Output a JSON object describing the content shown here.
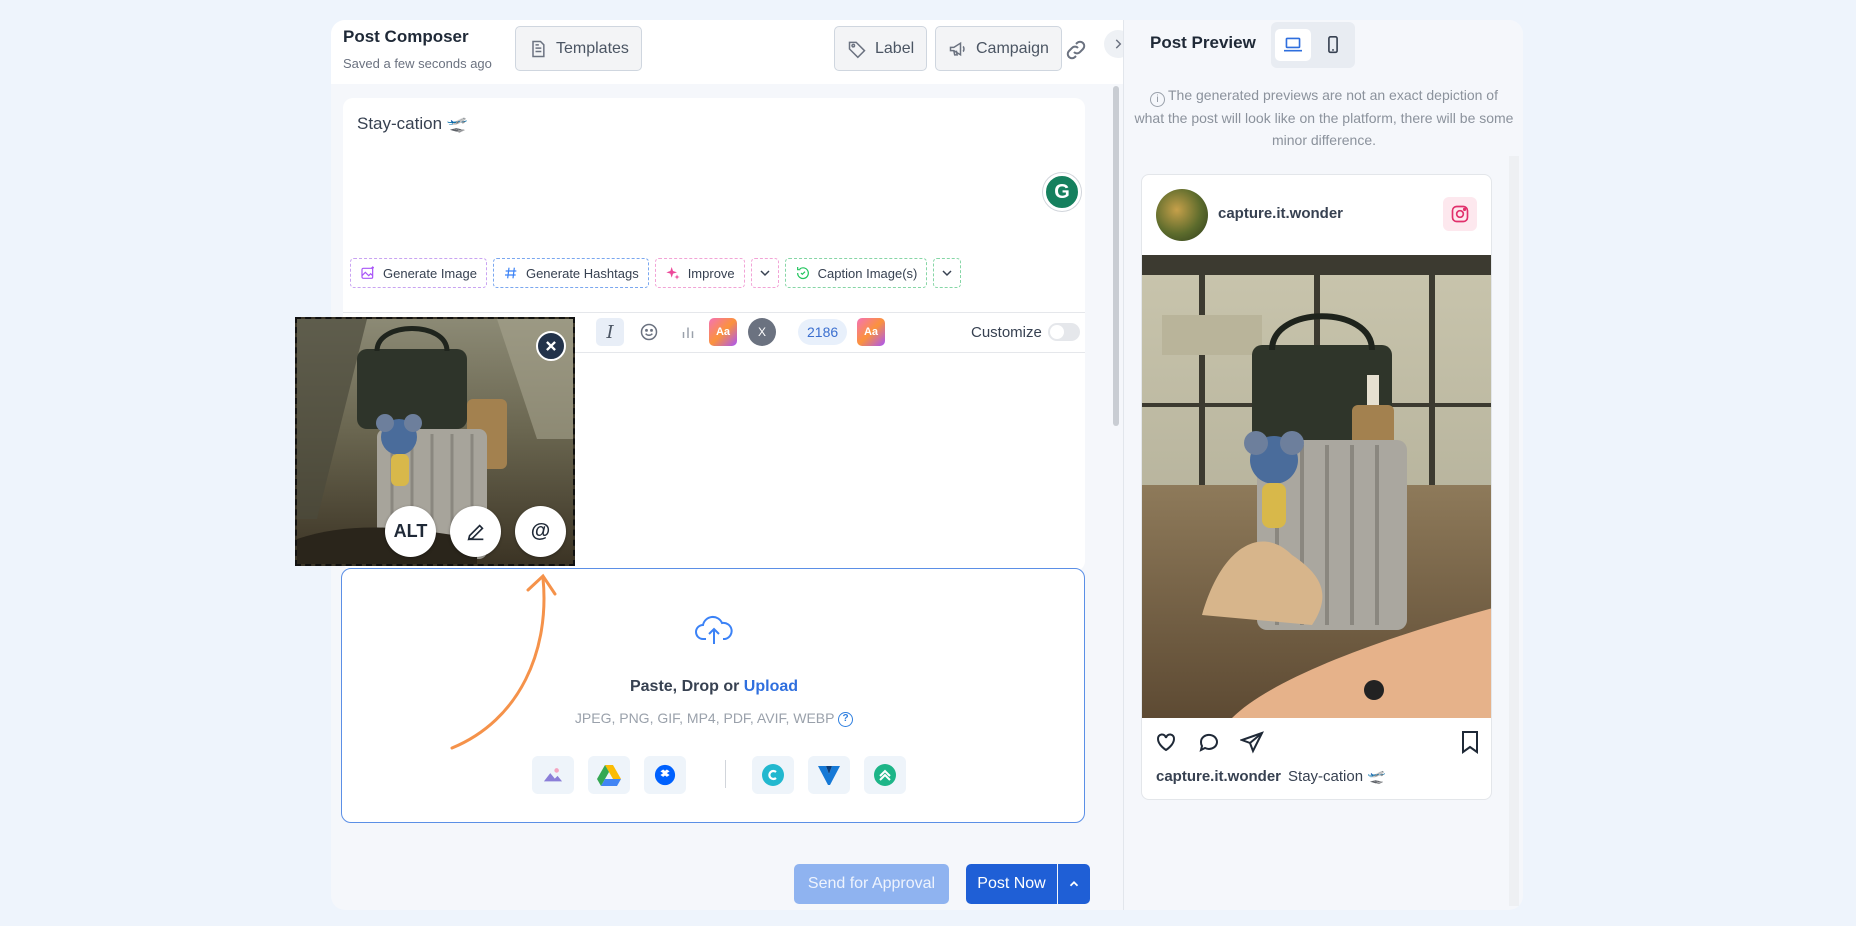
{
  "composer": {
    "title": "Post Composer",
    "saved_status": "Saved a few seconds ago",
    "templates_label": "Templates",
    "label_label": "Label",
    "campaign_label": "Campaign"
  },
  "editor": {
    "post_text": "Stay-cation 🛫",
    "ai_actions": {
      "generate_image": "Generate Image",
      "generate_hashtags": "Generate Hashtags",
      "improve": "Improve",
      "caption_images": "Caption Image(s)"
    },
    "character_count": "2186",
    "customize_label": "Customize",
    "customize_enabled": false
  },
  "media_thumb": {
    "alt_label": "ALT",
    "edit_icon": "pencil-icon",
    "mention_label": "@"
  },
  "upload": {
    "prompt_text": "Paste, Drop or ",
    "upload_link": "Upload",
    "formats": "JPEG, PNG, GIF, MP4, PDF, AVIF, WEBP",
    "help_mark": "?",
    "sources": [
      "media-library-icon",
      "google-drive-icon",
      "dropbox-icon",
      "canva-icon",
      "vistacreate-icon",
      "postnitro-icon"
    ]
  },
  "footer": {
    "send_for_approval": "Send for Approval",
    "post_now": "Post Now"
  },
  "preview": {
    "title": "Post Preview",
    "notice_mark": "i",
    "notice": "The generated previews are not an exact depiction of what the post will look like on the platform, there will be some minor difference.",
    "account_name": "capture.it.wonder",
    "caption": "Stay-cation 🛫",
    "device_active": "desktop"
  },
  "colors": {
    "primary": "#1f5fd6",
    "primary_disabled": "#8fb3f0",
    "accent_link": "#2f6fde",
    "instagram_pink": "#e1306c",
    "arrow_orange": "#f5924a"
  }
}
